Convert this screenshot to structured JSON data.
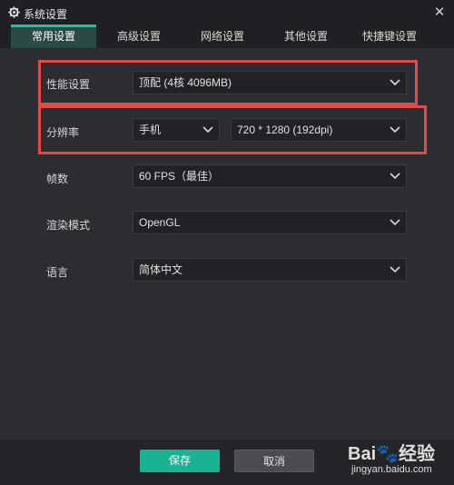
{
  "window": {
    "title": "系统设置",
    "close": "✕"
  },
  "tabs": [
    {
      "label": "常用设置",
      "active": true
    },
    {
      "label": "高级设置",
      "active": false
    },
    {
      "label": "网络设置",
      "active": false
    },
    {
      "label": "其他设置",
      "active": false
    },
    {
      "label": "快捷键设置",
      "active": false
    }
  ],
  "settings": {
    "performance": {
      "label": "性能设置",
      "value": "顶配 (4核 4096MB)"
    },
    "resolution": {
      "label": "分辨率",
      "device": "手机",
      "value": "720 * 1280 (192dpi)"
    },
    "fps": {
      "label": "帧数",
      "value": "60 FPS（最佳）"
    },
    "render": {
      "label": "渲染模式",
      "value": "OpenGL"
    },
    "language": {
      "label": "语言",
      "value": "简体中文"
    }
  },
  "buttons": {
    "save": "保存",
    "cancel": "取消"
  },
  "watermark": {
    "logo": "Bai🐾经验",
    "url": "jingyan.baidu.com"
  },
  "colors": {
    "accent": "#19c6a3",
    "highlight": "#e34a4a"
  }
}
